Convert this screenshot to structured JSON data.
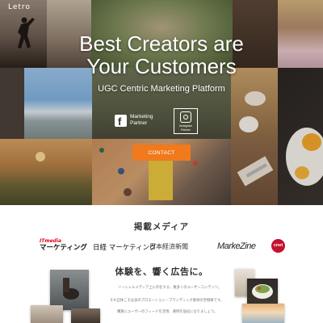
{
  "header": {
    "logo_text": "Letro"
  },
  "hero": {
    "title_line1": "Best Creators are",
    "title_line2": "Your Customers",
    "subtitle": "UGC Centric Marketing Platform",
    "facebook_badge": {
      "line1": "Marketing",
      "line2": "Partner"
    },
    "instagram_badge": {
      "line1": "Instagram",
      "line2": "Partner"
    },
    "contact_button": "CONTACT"
  },
  "media": {
    "heading": "掲載メディア",
    "logos": {
      "itmedia_top": "ITmedia",
      "itmedia_bottom": "マーケティング",
      "nikkei": "日経 マーケティング",
      "nihon_keizai": "日本経済新聞",
      "markezine": "MarkeZine",
      "cnet": "cnet"
    }
  },
  "feature": {
    "tagline": "体験を、響く広告に。",
    "desc_line1": "ソーシャルメディア上に存在する、数多くのユーザーコンテンツ。",
    "desc_line2": "それ自体こそは良のプロモーション・ブランディング素材の宝物庫です。",
    "desc_line3": "購買にユーザーのフィードを活用、運用を強化になりましょう。"
  },
  "colors": {
    "accent_orange": "#f07a1c",
    "cnet_red": "#c4122f",
    "itmedia_red": "#e2001a"
  }
}
